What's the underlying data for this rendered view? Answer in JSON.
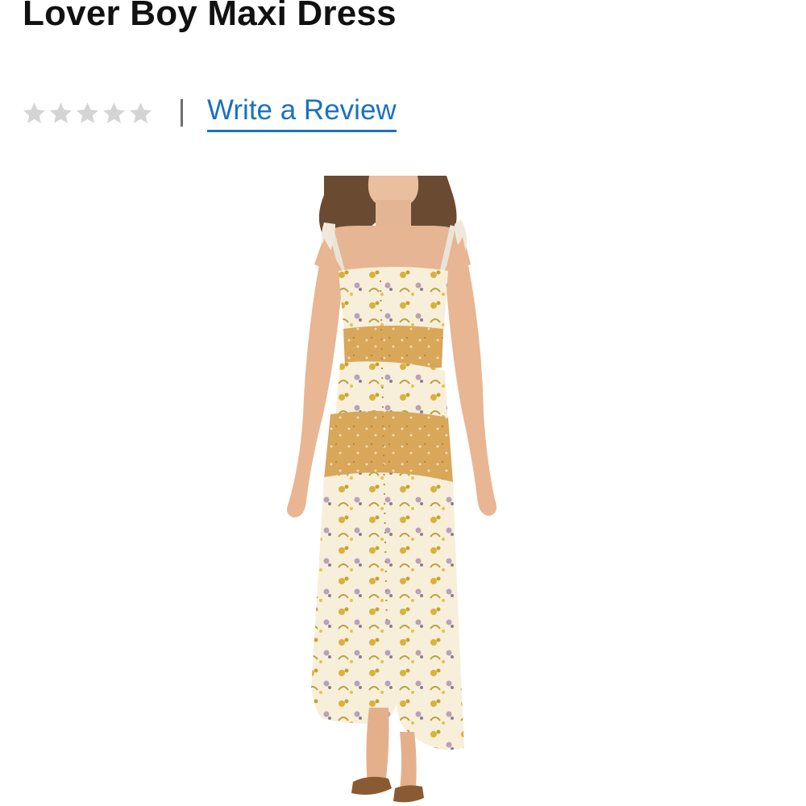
{
  "product": {
    "title": "Lover Boy Maxi Dress",
    "rating": {
      "value": 0,
      "max": 5,
      "star_color": "#d4d4d4",
      "icon": "star-icon"
    },
    "write_review_label": "Write a Review"
  },
  "colors": {
    "link": "#1a71c2",
    "title": "#111111",
    "divider": "#6f6f6f"
  }
}
